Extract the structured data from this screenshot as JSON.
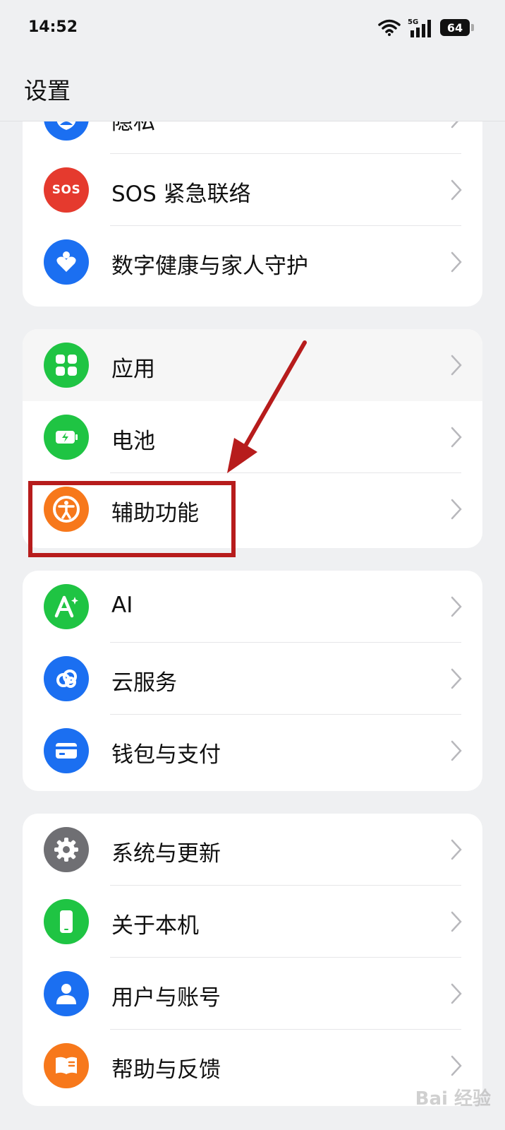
{
  "status_bar": {
    "time": "14:52",
    "network": "5G",
    "battery": "64"
  },
  "header": {
    "title": "设置"
  },
  "groups": [
    {
      "items": [
        {
          "label": "隐私",
          "icon": "privacy-icon",
          "color": "#1b6ff1"
        },
        {
          "label": "SOS 紧急联络",
          "icon": "sos-icon",
          "icon_text": "SOS",
          "color": "#e53a2e"
        },
        {
          "label": "数字健康与家人守护",
          "icon": "digital-wellbeing-icon",
          "color": "#1b6ff1"
        }
      ]
    },
    {
      "items": [
        {
          "label": "应用",
          "icon": "apps-icon",
          "color": "#1fc443"
        },
        {
          "label": "电池",
          "icon": "battery-icon",
          "color": "#1fc443"
        },
        {
          "label": "辅助功能",
          "icon": "accessibility-icon",
          "color": "#f7781b"
        }
      ]
    },
    {
      "items": [
        {
          "label": "AI",
          "icon": "ai-icon",
          "color": "#1fc443"
        },
        {
          "label": "云服务",
          "icon": "cloud-service-icon",
          "color": "#1b6ff1"
        },
        {
          "label": "钱包与支付",
          "icon": "wallet-icon",
          "color": "#1b6ff1"
        }
      ]
    },
    {
      "items": [
        {
          "label": "系统与更新",
          "icon": "gear-icon",
          "color": "#6f6f73"
        },
        {
          "label": "关于本机",
          "icon": "phone-icon",
          "color": "#1fc443"
        },
        {
          "label": "用户与账号",
          "icon": "user-icon",
          "color": "#1b6ff1"
        },
        {
          "label": "帮助与反馈",
          "icon": "help-book-icon",
          "color": "#f7781b"
        }
      ]
    }
  ],
  "annotation": {
    "arrow_color": "#b71c1c",
    "box_color": "#b71c1c"
  },
  "watermark": "Bai 经验"
}
